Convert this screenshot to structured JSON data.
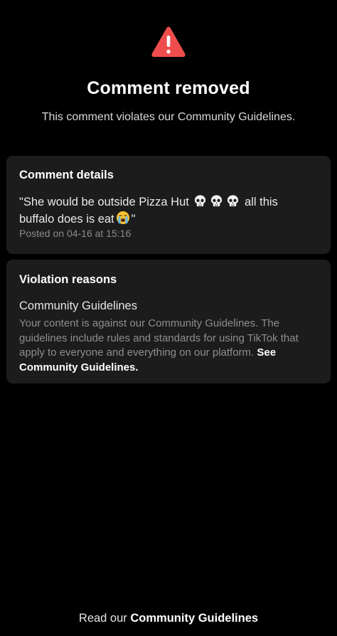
{
  "header": {
    "icon": "warning-triangle-icon",
    "title": "Comment removed",
    "subtitle": "This comment violates our Community Guidelines."
  },
  "comment_details": {
    "title": "Comment details",
    "text_part1": "\"She would be outside Pizza Hut",
    "text_part2": "all this buffalo does is eat",
    "text_part3": "\"",
    "emoji_skull": "💀",
    "emoji_crying": "😭",
    "posted": "Posted on 04-16 at 15:16"
  },
  "violation": {
    "title": "Violation reasons",
    "reason_name": "Community Guidelines",
    "description": "Your content is against our Community Guidelines. The guidelines include rules and standards for using TikTok that apply to everyone and everything on our platform.",
    "link_text": "See Community Guidelines."
  },
  "footer": {
    "prefix": "Read our",
    "link_text": "Community Guidelines"
  },
  "colors": {
    "background": "#000000",
    "card": "#1c1c1c",
    "warning": "#fe2c55",
    "text_primary": "#ffffff",
    "text_secondary": "#8e8e8e"
  }
}
